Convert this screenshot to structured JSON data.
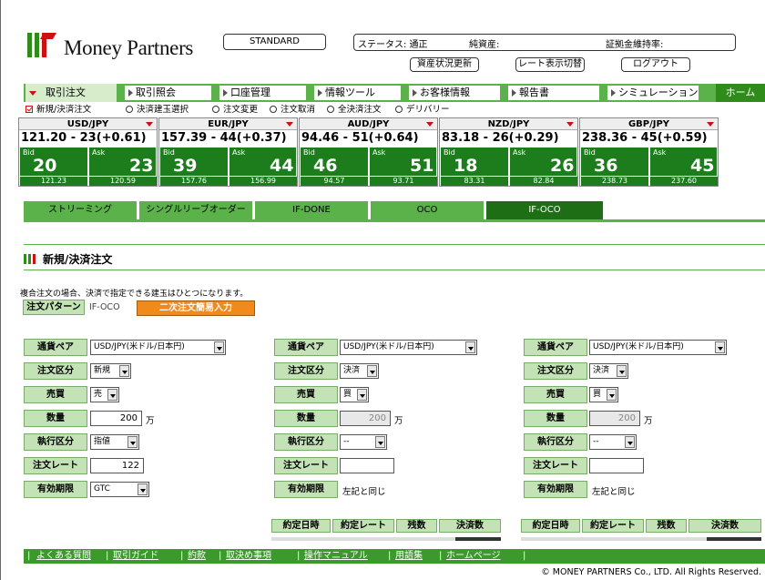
{
  "header": {
    "logo_text": "Money Partners",
    "standard_label": "STANDARD",
    "status_label": "ステータス: 通正",
    "pure_assets_label": "純資産:",
    "margin_rate_label": "証拠金維持率:",
    "refresh_assets_label": "資産状況更新",
    "rate_display_label": "レート表示切替",
    "logout_label": "ログアウト"
  },
  "nav": {
    "items": [
      "取引注文",
      "取引照会",
      "口座管理",
      "情報ツール",
      "お客様情報",
      "報告書",
      "シミュレーション"
    ],
    "home": "ホーム"
  },
  "subnav": [
    "新規/決済注文",
    "決済建玉選択",
    "注文変更",
    "注文取消",
    "全決済注文",
    "デリバリー"
  ],
  "quotes": [
    {
      "pair": "USD/JPY",
      "rate": "121.20 - 23(+0.61)",
      "bid": "20",
      "ask": "23",
      "high": "121.23",
      "low": "120.59"
    },
    {
      "pair": "EUR/JPY",
      "rate": "157.39 - 44(+0.37)",
      "bid": "39",
      "ask": "44",
      "high": "157.76",
      "low": "156.99"
    },
    {
      "pair": "AUD/JPY",
      "rate": "94.46 - 51(+0.64)",
      "bid": "46",
      "ask": "51",
      "high": "94.57",
      "low": "93.71"
    },
    {
      "pair": "NZD/JPY",
      "rate": "83.18 - 26(+0.29)",
      "bid": "18",
      "ask": "26",
      "high": "83.31",
      "low": "82.84"
    },
    {
      "pair": "GBP/JPY",
      "rate": "238.36 - 45(+0.59)",
      "bid": "36",
      "ask": "45",
      "high": "238.73",
      "low": "237.60"
    }
  ],
  "bid_label": "Bid",
  "ask_label": "Ask",
  "tabs": [
    "ストリーミング",
    "シングルリーブオーダー",
    "IF-DONE",
    "OCO",
    "IF-OCO"
  ],
  "section_title": "新規/決済注文",
  "note": "複合注文の場合、決済で指定できる建玉はひとつになります。",
  "pattern_label": "注文パターン",
  "pattern_value": "IF-OCO",
  "pattern_button": "二次注文簡易入力",
  "labels": {
    "pair": "通貨ペア",
    "type": "注文区分",
    "side": "売買",
    "qty": "数量",
    "exec": "執行区分",
    "rate": "注文レート",
    "expiry": "有効期限"
  },
  "orders": [
    {
      "pair": "USD/JPY(米ドル/日本円)",
      "type": "新規",
      "side": "売",
      "qty": "200",
      "exec": "指値",
      "rate": "122",
      "expiry": "GTC"
    },
    {
      "pair": "USD/JPY(米ドル/日本円)",
      "type": "決済",
      "side": "買",
      "qty": "200",
      "exec": "--",
      "rate": "",
      "expiry": "左記と同じ"
    },
    {
      "pair": "USD/JPY(米ドル/日本円)",
      "type": "決済",
      "side": "買",
      "qty": "200",
      "exec": "--",
      "rate": "",
      "expiry": "左記と同じ"
    }
  ],
  "unit": "万",
  "columns": [
    "約定日時",
    "約定レート",
    "残数",
    "決済数"
  ],
  "footer": [
    "よくある質問",
    "取引ガイド",
    "約款",
    "取決め事項",
    "操作マニュアル",
    "用語集",
    "ホームページ"
  ],
  "copyright": "© MONEY PARTNERS Co., LTD. All Rights Reserved."
}
